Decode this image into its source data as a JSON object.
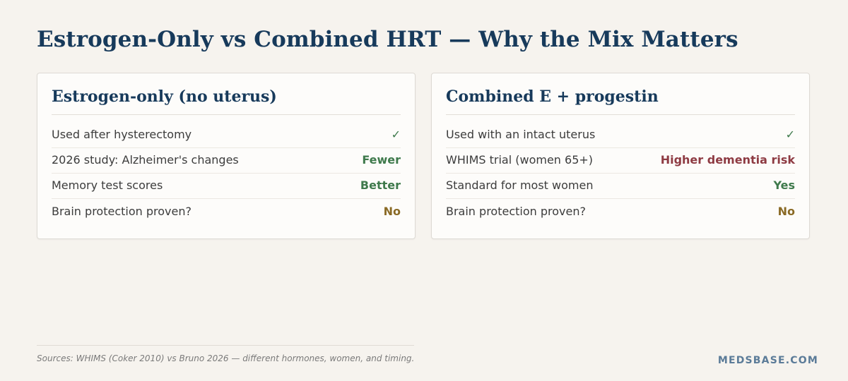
{
  "title": "Estrogen-Only vs Combined HRT — Why the Mix Matters",
  "cards": [
    {
      "title": "Estrogen-only (no uterus)",
      "rows": [
        {
          "label": "Used after hysterectomy",
          "value": "✓"
        },
        {
          "label": "2026 study: Alzheimer's changes",
          "value": "Fewer"
        },
        {
          "label": "Memory test scores",
          "value": "Better"
        },
        {
          "label": "Brain protection proven?",
          "value": "No"
        }
      ]
    },
    {
      "title": "Combined E + progestin",
      "rows": [
        {
          "label": "Used with an intact uterus",
          "value": "✓"
        },
        {
          "label": "WHIMS trial (women 65+)",
          "value": "Higher dementia risk"
        },
        {
          "label": "Standard for most women",
          "value": "Yes"
        },
        {
          "label": "Brain protection proven?",
          "value": "No"
        }
      ]
    }
  ],
  "colors": {
    "positive": "#3f7a4c",
    "negative": "#8e3b43",
    "neutral": "#8a6a25",
    "heading": "#173a5b"
  },
  "footer": {
    "source": "Sources: WHIMS (Coker 2010) vs Bruno 2026 — different hormones, women, and timing.",
    "brand": "MEDSBASE.COM"
  }
}
